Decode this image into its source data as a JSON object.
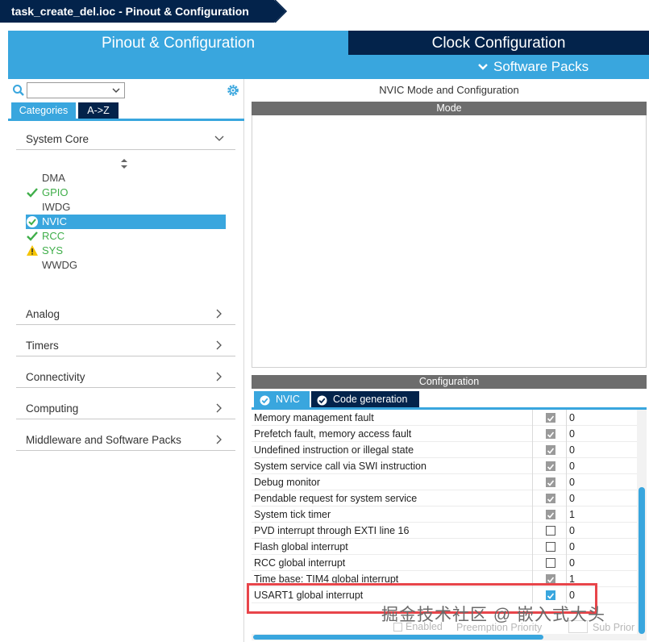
{
  "breadcrumb": {
    "title": "task_create_del.ioc - Pinout & Configuration"
  },
  "tabs": {
    "pinout": "Pinout & Configuration",
    "clock": "Clock Configuration",
    "software_packs": "Software Packs"
  },
  "left": {
    "category_tabs": [
      "Categories",
      "A->Z"
    ],
    "sections": {
      "system_core": "System Core",
      "analog": "Analog",
      "timers": "Timers",
      "connectivity": "Connectivity",
      "computing": "Computing",
      "middleware": "Middleware and Software Packs"
    },
    "peripherals": [
      {
        "name": "DMA",
        "status": "none"
      },
      {
        "name": "GPIO",
        "status": "ok"
      },
      {
        "name": "IWDG",
        "status": "none"
      },
      {
        "name": "NVIC",
        "status": "ok-selected"
      },
      {
        "name": "RCC",
        "status": "ok"
      },
      {
        "name": "SYS",
        "status": "warning"
      },
      {
        "name": "WWDG",
        "status": "none"
      }
    ]
  },
  "right": {
    "title": "NVIC Mode and Configuration",
    "mode_bar": "Mode",
    "config_bar": "Configuration",
    "config_tabs": {
      "nvic": "NVIC",
      "code_generation": "Code generation"
    },
    "rows": [
      {
        "name": "Memory management fault",
        "enabled": "locked",
        "priority": "0"
      },
      {
        "name": "Prefetch fault, memory access fault",
        "enabled": "locked",
        "priority": "0"
      },
      {
        "name": "Undefined instruction or illegal state",
        "enabled": "locked",
        "priority": "0"
      },
      {
        "name": "System service call via SWI instruction",
        "enabled": "locked",
        "priority": "0"
      },
      {
        "name": "Debug monitor",
        "enabled": "locked",
        "priority": "0"
      },
      {
        "name": "Pendable request for system service",
        "enabled": "locked",
        "priority": "0"
      },
      {
        "name": "System tick timer",
        "enabled": "locked",
        "priority": "1"
      },
      {
        "name": "PVD interrupt through EXTI line 16",
        "enabled": "off",
        "priority": "0"
      },
      {
        "name": "Flash global interrupt",
        "enabled": "off",
        "priority": "0"
      },
      {
        "name": "RCC global interrupt",
        "enabled": "off",
        "priority": "0"
      },
      {
        "name": "Time base: TIM4 global interrupt",
        "enabled": "locked",
        "priority": "1"
      },
      {
        "name": "USART1 global interrupt",
        "enabled": "on",
        "priority": "0"
      }
    ],
    "footer": {
      "enabled": "Enabled",
      "preemption": "Preemption Priority",
      "sub": "Sub Prior"
    },
    "watermark": "掘金技术社区 @ 嵌入式大头"
  },
  "colors": {
    "navy": "#03234b",
    "accent": "#39a6de",
    "ok": "#3fae49",
    "warning": "#f5c400",
    "highlight": "#e8454a"
  }
}
